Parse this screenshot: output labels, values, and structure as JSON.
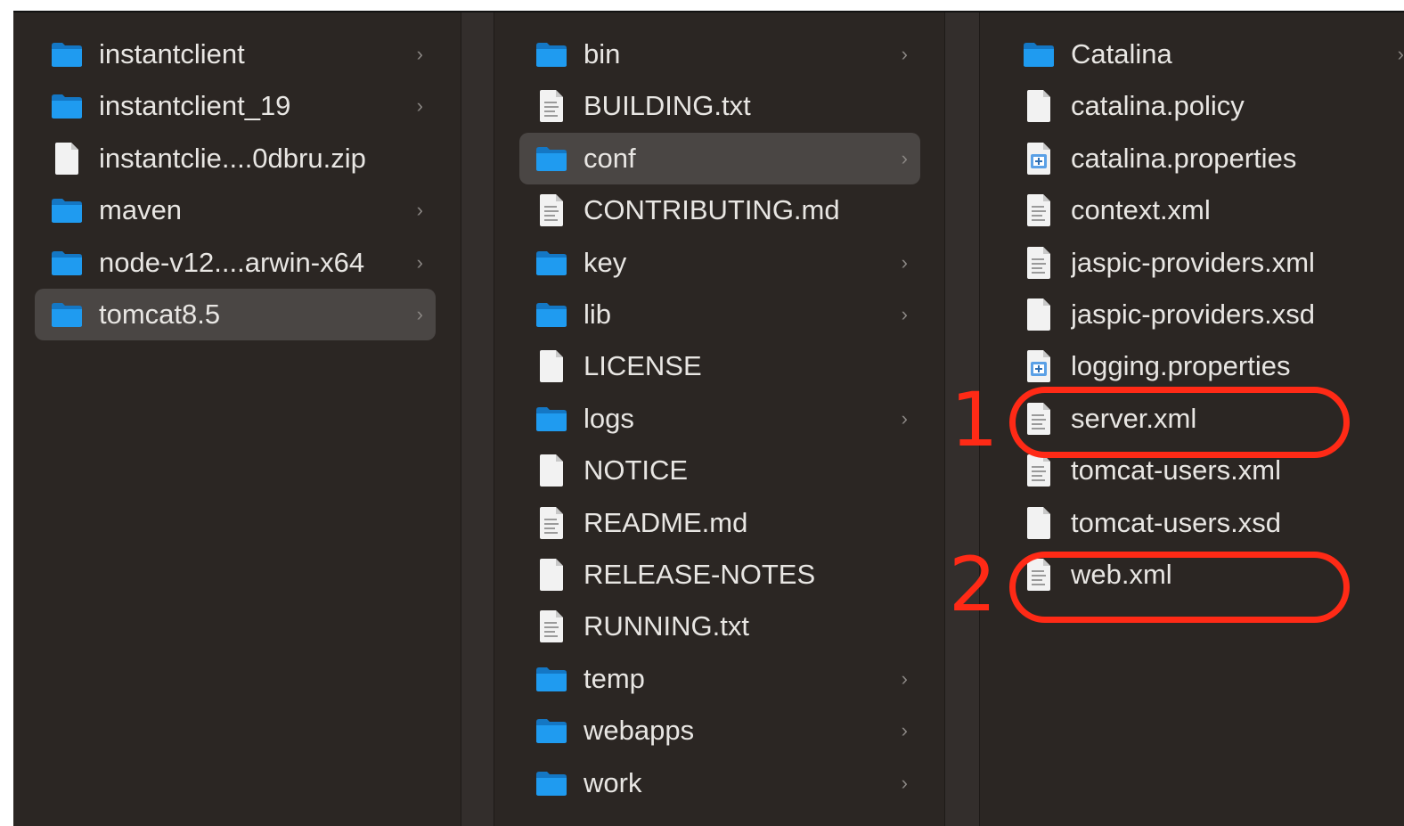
{
  "columns": [
    {
      "items": [
        {
          "name": "instantclient",
          "type": "folder",
          "chevron": true
        },
        {
          "name": "instantclient_19",
          "type": "folder",
          "chevron": true
        },
        {
          "name": "instantclie....0dbru.zip",
          "type": "file",
          "chevron": false
        },
        {
          "name": "maven",
          "type": "folder",
          "chevron": true
        },
        {
          "name": "node-v12....arwin-x64",
          "type": "folder",
          "chevron": true
        },
        {
          "name": "tomcat8.5",
          "type": "folder",
          "chevron": true,
          "selected": true
        }
      ]
    },
    {
      "items": [
        {
          "name": "bin",
          "type": "folder",
          "chevron": true
        },
        {
          "name": "BUILDING.txt",
          "type": "text",
          "chevron": false
        },
        {
          "name": "conf",
          "type": "folder",
          "chevron": true,
          "selected": true
        },
        {
          "name": "CONTRIBUTING.md",
          "type": "text",
          "chevron": false
        },
        {
          "name": "key",
          "type": "folder",
          "chevron": true
        },
        {
          "name": "lib",
          "type": "folder",
          "chevron": true
        },
        {
          "name": "LICENSE",
          "type": "file",
          "chevron": false
        },
        {
          "name": "logs",
          "type": "folder",
          "chevron": true
        },
        {
          "name": "NOTICE",
          "type": "file",
          "chevron": false
        },
        {
          "name": "README.md",
          "type": "text",
          "chevron": false
        },
        {
          "name": "RELEASE-NOTES",
          "type": "file",
          "chevron": false
        },
        {
          "name": "RUNNING.txt",
          "type": "text",
          "chevron": false
        },
        {
          "name": "temp",
          "type": "folder",
          "chevron": true
        },
        {
          "name": "webapps",
          "type": "folder",
          "chevron": true
        },
        {
          "name": "work",
          "type": "folder",
          "chevron": true
        }
      ]
    },
    {
      "items": [
        {
          "name": "Catalina",
          "type": "folder",
          "chevron": true
        },
        {
          "name": "catalina.policy",
          "type": "file",
          "chevron": false
        },
        {
          "name": "catalina.properties",
          "type": "properties",
          "chevron": false
        },
        {
          "name": "context.xml",
          "type": "text",
          "chevron": false
        },
        {
          "name": "jaspic-providers.xml",
          "type": "text",
          "chevron": false
        },
        {
          "name": "jaspic-providers.xsd",
          "type": "file",
          "chevron": false
        },
        {
          "name": "logging.properties",
          "type": "properties",
          "chevron": false
        },
        {
          "name": "server.xml",
          "type": "text",
          "chevron": false
        },
        {
          "name": "tomcat-users.xml",
          "type": "text",
          "chevron": false
        },
        {
          "name": "tomcat-users.xsd",
          "type": "file",
          "chevron": false
        },
        {
          "name": "web.xml",
          "type": "text",
          "chevron": false
        }
      ]
    }
  ],
  "chevron_glyph": "›",
  "annotations": [
    {
      "number": "1",
      "target": "server.xml"
    },
    {
      "number": "2",
      "target": "web.xml"
    }
  ],
  "colors": {
    "folder": "#1f9bf0",
    "annotation": "#ff2a16",
    "selection": "#4a4644",
    "background": "#2b2623"
  },
  "icon_names": {
    "folder": "folder-icon",
    "file": "document-icon",
    "text": "text-document-icon",
    "properties": "properties-file-icon"
  }
}
